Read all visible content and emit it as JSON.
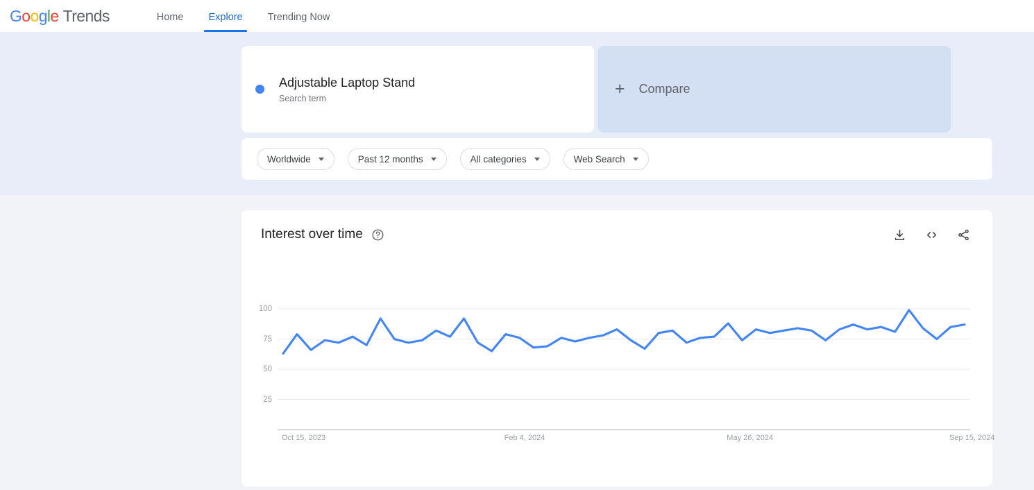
{
  "brand": {
    "logo_letters": [
      "G",
      "o",
      "o",
      "g",
      "l",
      "e"
    ],
    "logo_word": "Trends",
    "accent_blue": "#1a73e8",
    "series_blue": "#4285f4"
  },
  "nav": {
    "items": [
      {
        "label": "Home",
        "active": false
      },
      {
        "label": "Explore",
        "active": true
      },
      {
        "label": "Trending Now",
        "active": false
      }
    ]
  },
  "query": {
    "term": {
      "title": "Adjustable Laptop Stand",
      "subtitle": "Search term",
      "dot_color": "#4285f4"
    },
    "compare": {
      "label": "Compare",
      "plus_icon": "plus-icon"
    }
  },
  "filters": [
    {
      "name": "location",
      "label": "Worldwide"
    },
    {
      "name": "time-range",
      "label": "Past 12 months"
    },
    {
      "name": "category",
      "label": "All categories"
    },
    {
      "name": "search-type",
      "label": "Web Search"
    }
  ],
  "chart_card": {
    "title": "Interest over time",
    "help_icon": "question-mark-circle-icon",
    "actions": [
      {
        "name": "download-csv-button",
        "icon": "download-icon"
      },
      {
        "name": "embed-button",
        "icon": "code-brackets-icon"
      },
      {
        "name": "share-button",
        "icon": "share-icon"
      }
    ]
  },
  "chart_data": {
    "type": "line",
    "title": "Interest over time",
    "xlabel": "",
    "ylabel": "",
    "ylim": [
      0,
      100
    ],
    "yticks": [
      25,
      50,
      75,
      100
    ],
    "grid": true,
    "legend": false,
    "series_color": "#4285f4",
    "x_tick_labels": [
      "Oct 15, 2023",
      "Feb 4, 2024",
      "May 26, 2024",
      "Sep 15, 2024"
    ],
    "x_tick_positions": [
      0,
      16,
      32,
      48
    ],
    "series": [
      {
        "name": "Adjustable Laptop Stand",
        "values": [
          63,
          79,
          66,
          74,
          72,
          77,
          70,
          92,
          75,
          72,
          74,
          82,
          77,
          92,
          72,
          65,
          79,
          76,
          68,
          69,
          76,
          73,
          76,
          78,
          83,
          74,
          67,
          80,
          82,
          72,
          76,
          77,
          88,
          74,
          83,
          80,
          82,
          84,
          82,
          74,
          83,
          87,
          83,
          85,
          81,
          99,
          84,
          75,
          85,
          87
        ]
      }
    ]
  }
}
